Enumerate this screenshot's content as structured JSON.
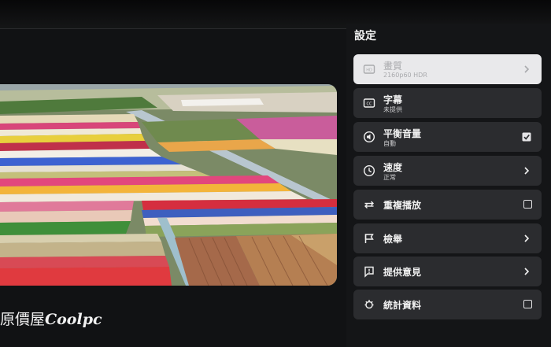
{
  "watermark": {
    "prefix": "原價屋",
    "brand": "Coolpc"
  },
  "settings": {
    "title": "設定",
    "items": [
      {
        "label": "畫質",
        "sub": "2160p60 HDR",
        "icon": "hd-icon",
        "trailing": "chevron",
        "focused": true
      },
      {
        "label": "字幕",
        "sub": "未提供",
        "icon": "cc-icon",
        "trailing": "none"
      },
      {
        "label": "平衡音量",
        "sub": "自動",
        "icon": "volume-icon",
        "trailing": "checkbox-checked"
      },
      {
        "label": "速度",
        "sub": "正常",
        "icon": "speed-icon",
        "trailing": "chevron"
      },
      {
        "label": "重複播放",
        "sub": "",
        "icon": "repeat-icon",
        "trailing": "checkbox"
      },
      {
        "label": "檢舉",
        "sub": "",
        "icon": "flag-icon",
        "trailing": "chevron"
      },
      {
        "label": "提供意見",
        "sub": "",
        "icon": "feedback-icon",
        "trailing": "chevron"
      },
      {
        "label": "統計資料",
        "sub": "",
        "icon": "stats-icon",
        "trailing": "checkbox"
      }
    ]
  },
  "colors": {
    "panel": "#141517",
    "item": "#2b2c2f",
    "focused_item": "#e9e9eb",
    "text": "#f1f1f1"
  }
}
